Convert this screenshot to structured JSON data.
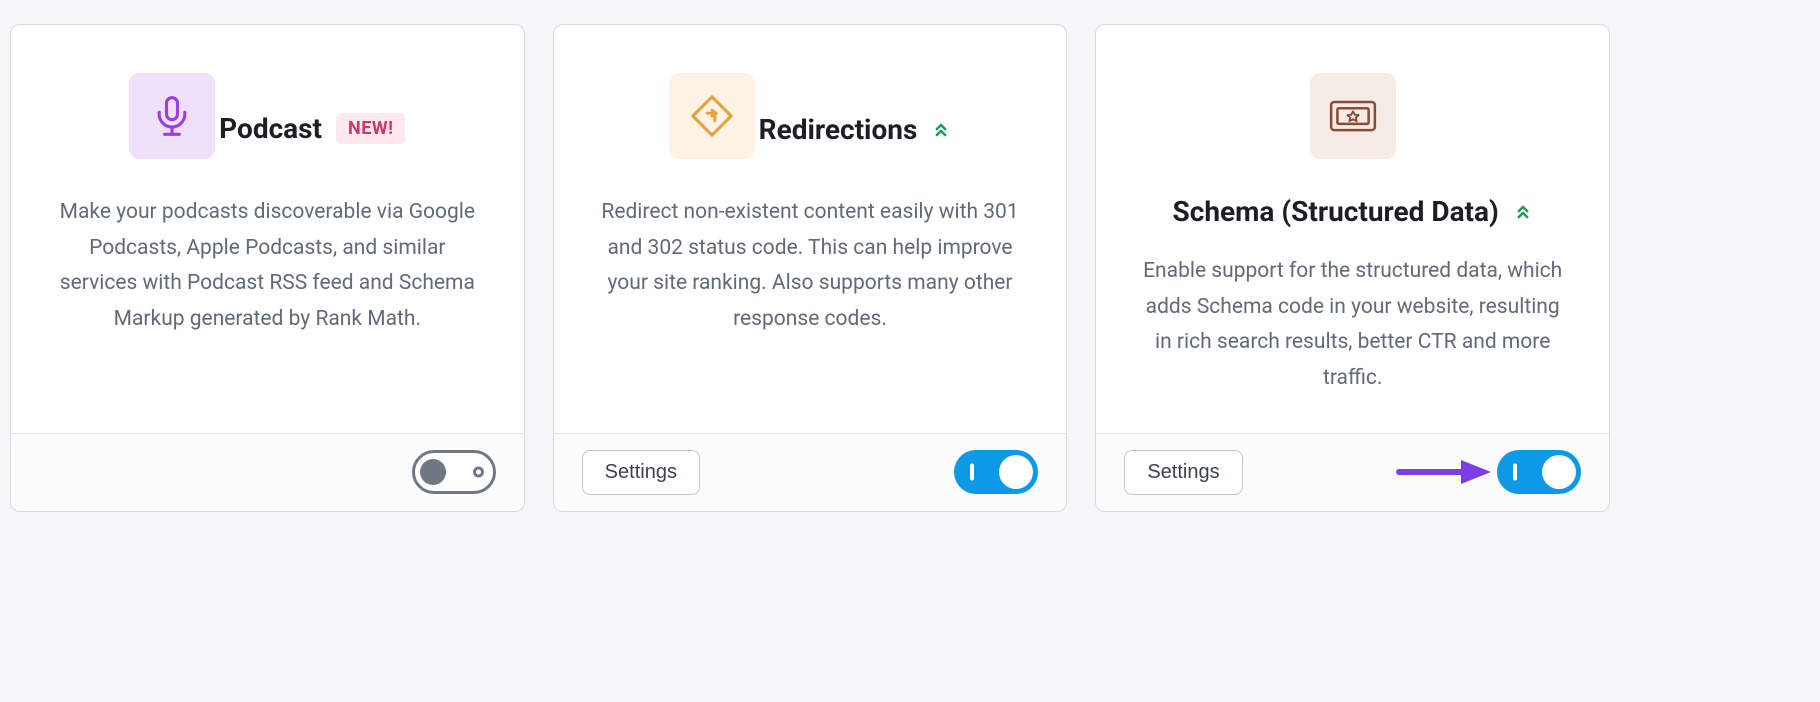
{
  "cards": [
    {
      "id": "podcast",
      "icon": "microphone-icon",
      "icon_bg": "purple",
      "title": "Podcast",
      "badge": "NEW!",
      "pro_indicator": false,
      "description": "Make your podcasts discoverable via Google Podcasts, Apple Podcasts, and similar services with Podcast RSS feed and Schema Markup generated by Rank Math.",
      "has_settings": false,
      "settings_label": "",
      "toggle_state": "off"
    },
    {
      "id": "redirections",
      "icon": "redirect-icon",
      "icon_bg": "orange",
      "title": "Redirections",
      "badge": null,
      "pro_indicator": true,
      "description": "Redirect non-existent content easily with 301 and 302 status code. This can help improve your site ranking. Also supports many other response codes.",
      "has_settings": true,
      "settings_label": "Settings",
      "toggle_state": "on"
    },
    {
      "id": "schema",
      "icon": "schema-icon",
      "icon_bg": "brown",
      "title": "Schema (Structured Data)",
      "badge": null,
      "pro_indicator": true,
      "description": "Enable support for the structured data, which adds Schema code in your website, resulting in rich search results, better CTR and more traffic.",
      "has_settings": true,
      "settings_label": "Settings",
      "toggle_state": "on",
      "annotation_arrow": true
    }
  ],
  "colors": {
    "accent_blue": "#0d99e6",
    "purple": "#9b3fe0",
    "orange": "#e8a33d",
    "brown": "#8c4a36",
    "pink": "#d6336c",
    "arrow_purple": "#7b3fe4"
  }
}
